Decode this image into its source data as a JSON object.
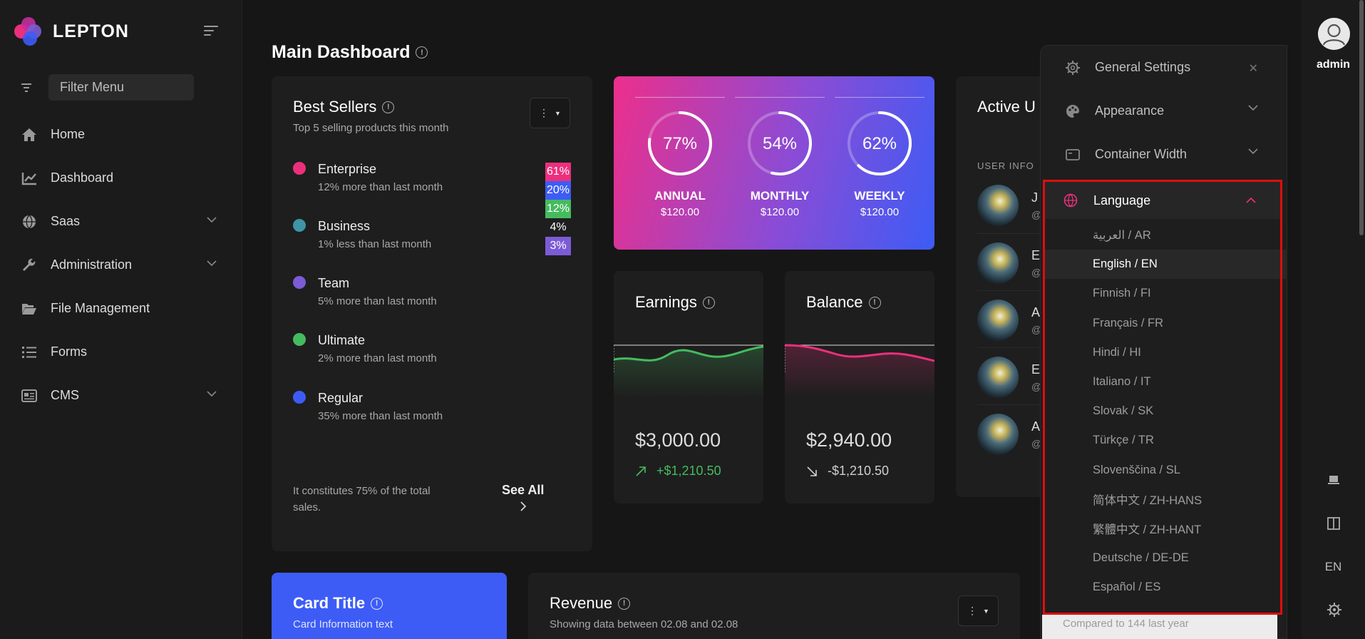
{
  "brand": {
    "name": "LEPTON"
  },
  "sidebar": {
    "filter_placeholder": "Filter Menu",
    "items": [
      {
        "label": "Home",
        "icon": "home-icon",
        "has_submenu": false
      },
      {
        "label": "Dashboard",
        "icon": "chart-line-icon",
        "has_submenu": false
      },
      {
        "label": "Saas",
        "icon": "globe-icon",
        "has_submenu": true
      },
      {
        "label": "Administration",
        "icon": "wrench-icon",
        "has_submenu": true
      },
      {
        "label": "File Management",
        "icon": "folder-open-icon",
        "has_submenu": false
      },
      {
        "label": "Forms",
        "icon": "list-icon",
        "has_submenu": false
      },
      {
        "label": "CMS",
        "icon": "newspaper-icon",
        "has_submenu": true
      }
    ]
  },
  "page": {
    "title": "Main Dashboard"
  },
  "best_sellers": {
    "title": "Best Sellers",
    "subtitle": "Top 5 selling products this month",
    "items": [
      {
        "name": "Enterprise",
        "delta": "12% more than last month",
        "color": "#ec2f7d"
      },
      {
        "name": "Business",
        "delta": "1% less than last month",
        "color": "#3f94a7"
      },
      {
        "name": "Team",
        "delta": "5% more than last month",
        "color": "#7b5cd6"
      },
      {
        "name": "Ultimate",
        "delta": "2% more than last month",
        "color": "#45bb5f"
      },
      {
        "name": "Regular",
        "delta": "35% more than last month",
        "color": "#3d5cf6"
      }
    ],
    "percentages": [
      {
        "value": "61%",
        "color": "#ec2f7d"
      },
      {
        "value": "20%",
        "color": "#3d5cf6"
      },
      {
        "value": "12%",
        "color": "#45bb5f"
      },
      {
        "value": "4%",
        "color": ""
      },
      {
        "value": "3%",
        "color": "#7b5cd6"
      }
    ],
    "footer": "It constitutes 75% of the total sales.",
    "see_all": "See All"
  },
  "stats": [
    {
      "percent": "77%",
      "fraction": 0.77,
      "label": "ANNUAL",
      "amount": "$120.00"
    },
    {
      "percent": "54%",
      "fraction": 0.54,
      "label": "MONTHLY",
      "amount": "$120.00"
    },
    {
      "percent": "62%",
      "fraction": 0.62,
      "label": "WEEKLY",
      "amount": "$120.00"
    }
  ],
  "earnings": {
    "title": "Earnings",
    "amount": "$3,000.00",
    "change": "+$1,210.50",
    "color": "#45bb5f"
  },
  "balance": {
    "title": "Balance",
    "amount": "$2,940.00",
    "change": "-$1,210.50",
    "color": "#ec2f7d"
  },
  "active_users": {
    "title": "Active U",
    "header": "USER INFO",
    "users": [
      {
        "initial": "J",
        "handle": "@"
      },
      {
        "initial": "E",
        "handle": "@"
      },
      {
        "initial": "A",
        "handle": "@"
      },
      {
        "initial": "E",
        "handle": "@"
      },
      {
        "initial": "A",
        "handle": "@"
      }
    ]
  },
  "card_blue": {
    "title": "Card Title",
    "subtitle": "Card Information text"
  },
  "revenue": {
    "title": "Revenue",
    "subtitle": "Showing data between 02.08 and 02.08"
  },
  "settings": {
    "general": "General Settings",
    "appearance": "Appearance",
    "container_width": "Container Width",
    "language": "Language",
    "languages": [
      "العربية / AR",
      "English / EN",
      "Finnish / FI",
      "Français / FR",
      "Hindi / HI",
      "Italiano / IT",
      "Slovak / SK",
      "Türkçe / TR",
      "Slovenščina / SL",
      "简体中文 / ZH-HANS",
      "繁體中文 / ZH-HANT",
      "Deutsche / DE-DE",
      "Español / ES"
    ],
    "active_language_index": 1,
    "compared_text": "Compared to 144 last year"
  },
  "user": {
    "name": "admin",
    "language_code": "EN"
  },
  "colors": {
    "accent_red": "#e00d0d",
    "brand_pink": "#ec2f8b",
    "brand_blue": "#3d5cf6"
  }
}
